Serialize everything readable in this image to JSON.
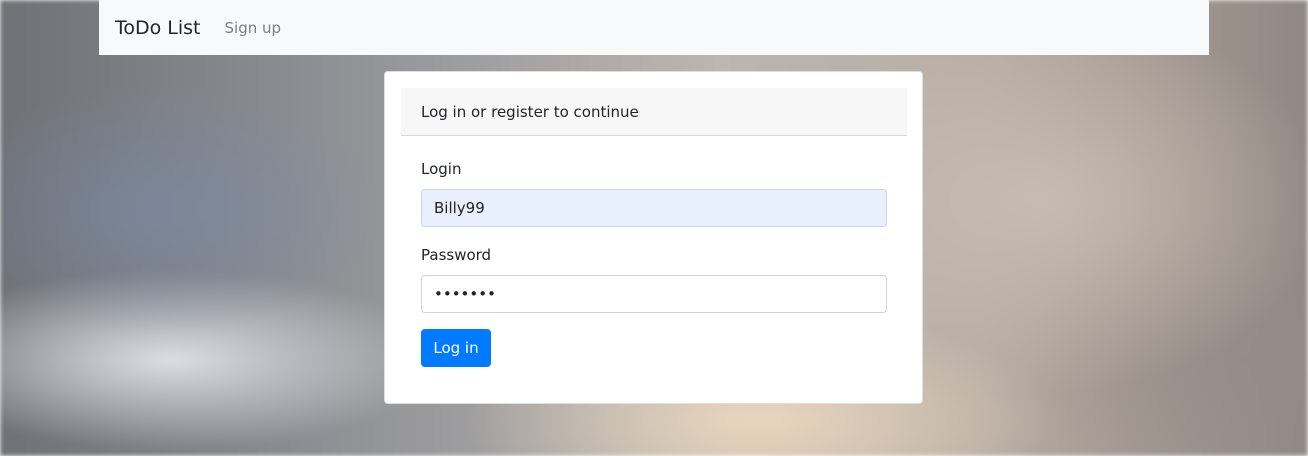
{
  "navbar": {
    "brand": "ToDo List",
    "signup_link": "Sign up"
  },
  "card": {
    "header": "Log in or register to continue",
    "login_label": "Login",
    "login_value": "Billy99",
    "password_label": "Password",
    "password_value": "1234567",
    "submit_label": "Log in"
  },
  "colors": {
    "primary": "#007bff",
    "navbar_bg": "#f8f9fa",
    "autofill_bg": "#e8f0fe"
  }
}
